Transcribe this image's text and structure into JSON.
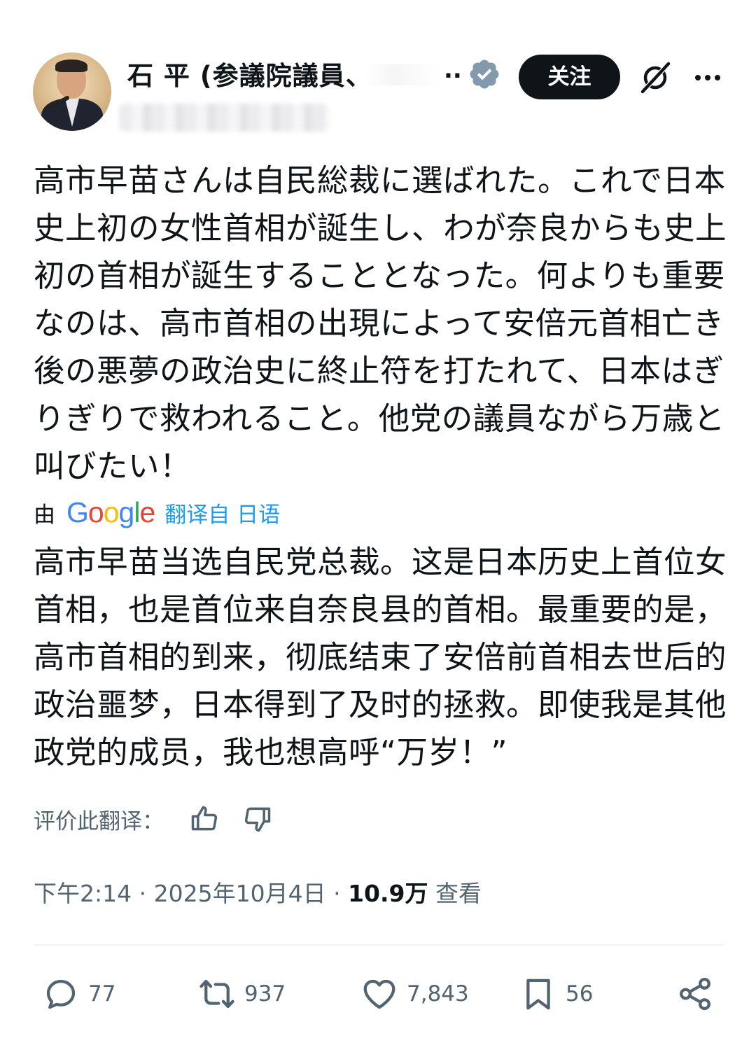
{
  "header": {
    "display_name": "石 平 (参議院議員、",
    "name_ellipsis": "..",
    "verified_icon": "verified-badge-icon",
    "follow_label": "关注",
    "grok_icon": "grok-icon",
    "more_icon": "more-icon"
  },
  "post": {
    "text": "高市早苗さんは自民総裁に選ばれた。これで日本史上初の女性首相が誕生し、わが奈良からも史上初の首相が誕生することとなった。何よりも重要なのは、高市首相の出現によって安倍元首相亡き後の悪夢の政治史に終止符を打たれて、日本はぎりぎりで救われること。他党の議員ながら万歳と叫びたい！",
    "translated_by_prefix": "由",
    "translation_source": "Google",
    "translated_from": "翻译自 日语",
    "translation": "高市早苗当选自民党总裁。这是日本历史上首位女首相，也是首位来自奈良县的首相。最重要的是，高市首相的到来，彻底结束了安倍前首相去世后的政治噩梦，日本得到了及时的拯救。即使我是其他政党的成员，我也想高呼“万岁！”",
    "rate_label": "评价此翻译：",
    "thumbs_up_icon": "thumbs-up-icon",
    "thumbs_down_icon": "thumbs-down-icon"
  },
  "meta": {
    "time": "下午2:14",
    "separator": " · ",
    "date": "2025年10月4日",
    "views_count": "10.9万",
    "views_label": "查看"
  },
  "actions": {
    "replies": "77",
    "reposts": "937",
    "likes": "7,843",
    "bookmarks": "56",
    "icons": [
      "reply-icon",
      "repost-icon",
      "like-icon",
      "bookmark-icon",
      "share-icon"
    ]
  },
  "colors": {
    "text": "#0f1419",
    "secondary": "#536471",
    "link": "#1d9bf0",
    "verified": "#829aab",
    "follow_bg": "#0f1419"
  }
}
